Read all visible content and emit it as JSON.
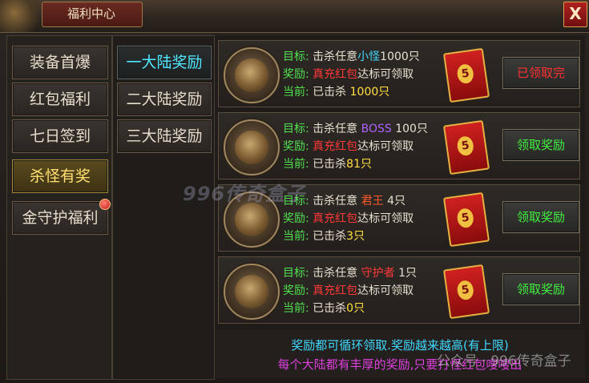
{
  "window": {
    "title": "福利中心",
    "close_label": "X"
  },
  "sidebar": {
    "items": [
      {
        "label": "装备首爆",
        "active": false
      },
      {
        "label": "红包福利",
        "active": false
      },
      {
        "label": "七日签到",
        "active": false
      },
      {
        "label": "杀怪有奖",
        "active": true
      },
      {
        "label": "金守护福利",
        "active": false,
        "badge": true
      }
    ]
  },
  "tabs": {
    "items": [
      {
        "label": "一大陆奖励",
        "active": true
      },
      {
        "label": "二大陆奖励",
        "active": false
      },
      {
        "label": "三大陆奖励",
        "active": false
      }
    ]
  },
  "rewards": [
    {
      "target_key": "目标:",
      "target_prefix": "击杀任意",
      "target_name": "小怪",
      "target_count": "1000只",
      "reward_key": "奖励:",
      "reward_name": "真充红包",
      "reward_suffix": "达标可领取",
      "current_key": "当前:",
      "current_prefix": "已击杀",
      "current_count": "1000只",
      "envelope": "5",
      "button": "已领取完",
      "button_state": "done"
    },
    {
      "target_key": "目标:",
      "target_prefix": "击杀任意",
      "target_name": "BOSS",
      "target_count": "100只",
      "reward_key": "奖励:",
      "reward_name": "真充红包",
      "reward_suffix": "达标可领取",
      "current_key": "当前:",
      "current_prefix": "已击杀",
      "current_count": "81只",
      "envelope": "5",
      "button": "领取奖励",
      "button_state": "available"
    },
    {
      "target_key": "目标:",
      "target_prefix": "击杀任意",
      "target_name": "君王",
      "target_count": "4只",
      "reward_key": "奖励:",
      "reward_name": "真充红包",
      "reward_suffix": "达标可领取",
      "current_key": "当前:",
      "current_prefix": "已击杀",
      "current_count": "3只",
      "envelope": "5",
      "button": "领取奖励",
      "button_state": "available"
    },
    {
      "target_key": "目标:",
      "target_prefix": "击杀任意",
      "target_name": "守护者",
      "target_count": "1只",
      "reward_key": "奖励:",
      "reward_name": "真充红包",
      "reward_suffix": "达标可领取",
      "current_key": "当前:",
      "current_prefix": "已击杀",
      "current_count": "0只",
      "envelope": "5",
      "button": "领取奖励",
      "button_state": "available"
    }
  ],
  "footer": {
    "line1": "奖励都可循环领取.奖励越来越高(有上限)",
    "line2": "每个大陆都有丰厚的奖励,只要打怪红包嗖嗖出"
  },
  "watermarks": {
    "center": "996传奇盒子",
    "corner": "公众号 · 996传奇盒子"
  },
  "colors": {
    "accent_active_tab": "#50e8ff",
    "active_sidebar": "#ffe070",
    "claimed": "#ff3030",
    "claimable": "#40f040"
  }
}
